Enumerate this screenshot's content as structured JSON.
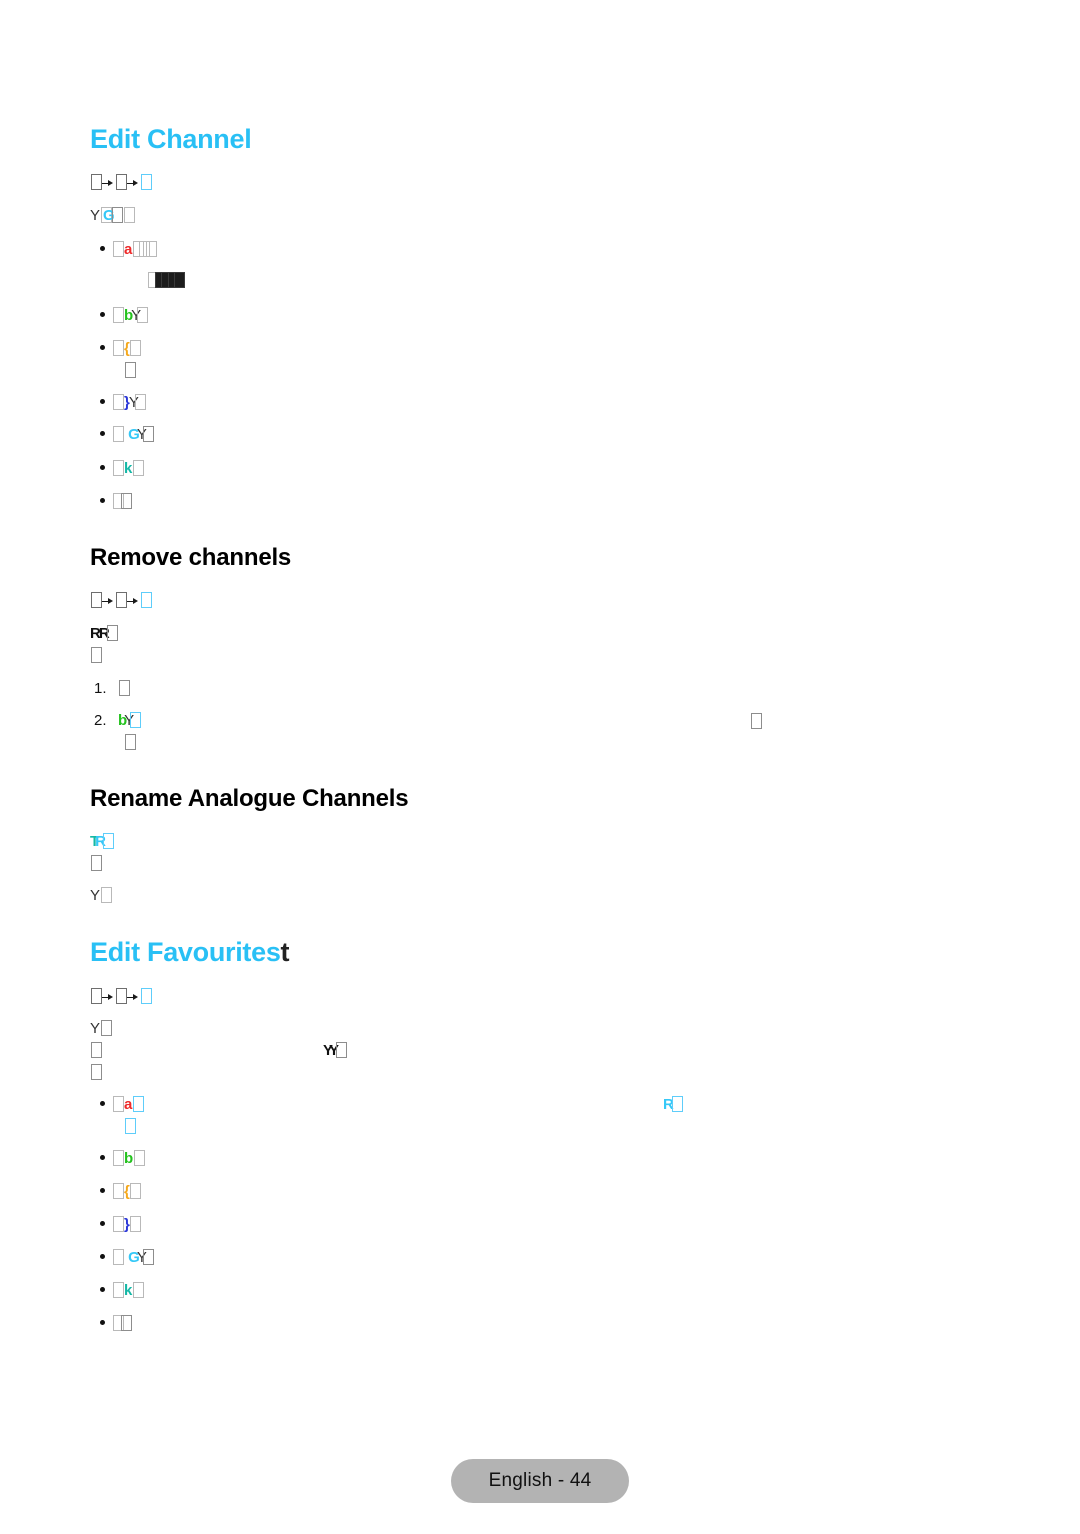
{
  "document": {
    "kind": "tv-user-manual-page",
    "page_label": "English - 44",
    "background_color": "#ffffff",
    "heading_accent_color": "#29c0f5",
    "footer_pill_color": "#b3b3b3"
  },
  "sections": {
    "edit_channel": {
      "heading": "Edit Channel",
      "breadcrumb_note": "menu-path breadcrumb with two arrow separators and unrendered labels",
      "intro_note": "Y + unrendered glyphs",
      "bullets": [
        {
          "key_color": "#ef2a2a",
          "key_glyph": "a"
        },
        {
          "key_color": "#24c21e",
          "key_glyph": "b"
        },
        {
          "key_color": "#f5a81c",
          "key_glyph": "{"
        },
        {
          "key_color": "#2a36d8",
          "key_glyph": "}"
        },
        {
          "key_color": "#35c8f7",
          "key_glyph": "G"
        },
        {
          "key_color": "#14b8a6",
          "key_glyph": "k"
        },
        {
          "key_color": "#8d8d8d",
          "key_glyph": ""
        }
      ]
    },
    "remove_channels": {
      "heading": "Remove channels",
      "intro_glyphs": "RR",
      "steps": [
        {
          "index": "1.",
          "glyph": ""
        },
        {
          "index": "2.",
          "glyph": "b",
          "glyph_color": "#24c21e"
        }
      ]
    },
    "rename_analogue_channels": {
      "heading": "Rename Analogue Channels",
      "intro_glyphs": "TR",
      "second_line_glyph": "Y"
    },
    "edit_favourites": {
      "heading": "Edit Favourites",
      "heading_tail": "t",
      "intro_glyph": "Y",
      "mid_glyphs": "YY",
      "right_glyph": "R",
      "right_glyph_color": "#35c8f7",
      "bullets": [
        {
          "key_color": "#ef2a2a",
          "key_glyph": "a"
        },
        {
          "key_color": "#24c21e",
          "key_glyph": "b"
        },
        {
          "key_color": "#f5a81c",
          "key_glyph": "{"
        },
        {
          "key_color": "#2a36d8",
          "key_glyph": "}"
        },
        {
          "key_color": "#35c8f7",
          "key_glyph": "G"
        },
        {
          "key_color": "#14b8a6",
          "key_glyph": "k"
        },
        {
          "key_color": "#8d8d8d",
          "key_glyph": ""
        }
      ]
    }
  },
  "footer": {
    "label": "English - 44"
  }
}
